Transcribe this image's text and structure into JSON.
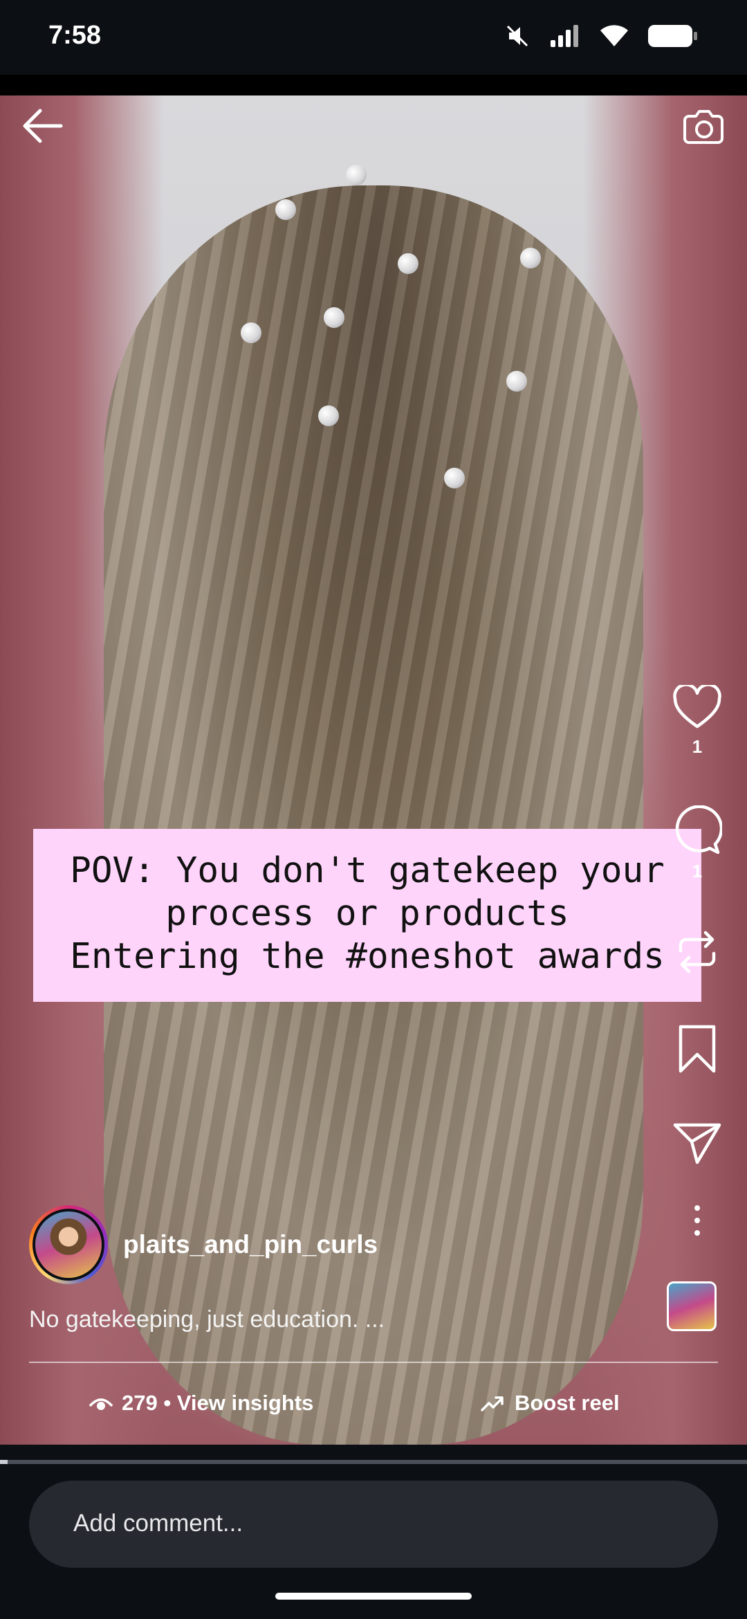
{
  "status_bar": {
    "time": "7:58",
    "icons": [
      "mute-icon",
      "signal-icon",
      "wifi-icon",
      "battery-icon"
    ]
  },
  "reel": {
    "overlay_text": [
      "POV: You don't gatekeep your",
      "process or products",
      "Entering the #oneshot awards"
    ],
    "like_count": "1",
    "comment_count": "1"
  },
  "author": {
    "username": "plaits_and_pin_curls"
  },
  "description": "No gatekeeping, just education. ...",
  "stats": {
    "views": "279 • View insights",
    "boost_label": "Boost reel"
  },
  "playback": {
    "progress": 0.01
  },
  "comment": {
    "placeholder": "Add comment..."
  },
  "colors": {
    "caption_bg": "#ffd4fb",
    "background": "#0c0f14",
    "comment_bar": "#262930"
  }
}
